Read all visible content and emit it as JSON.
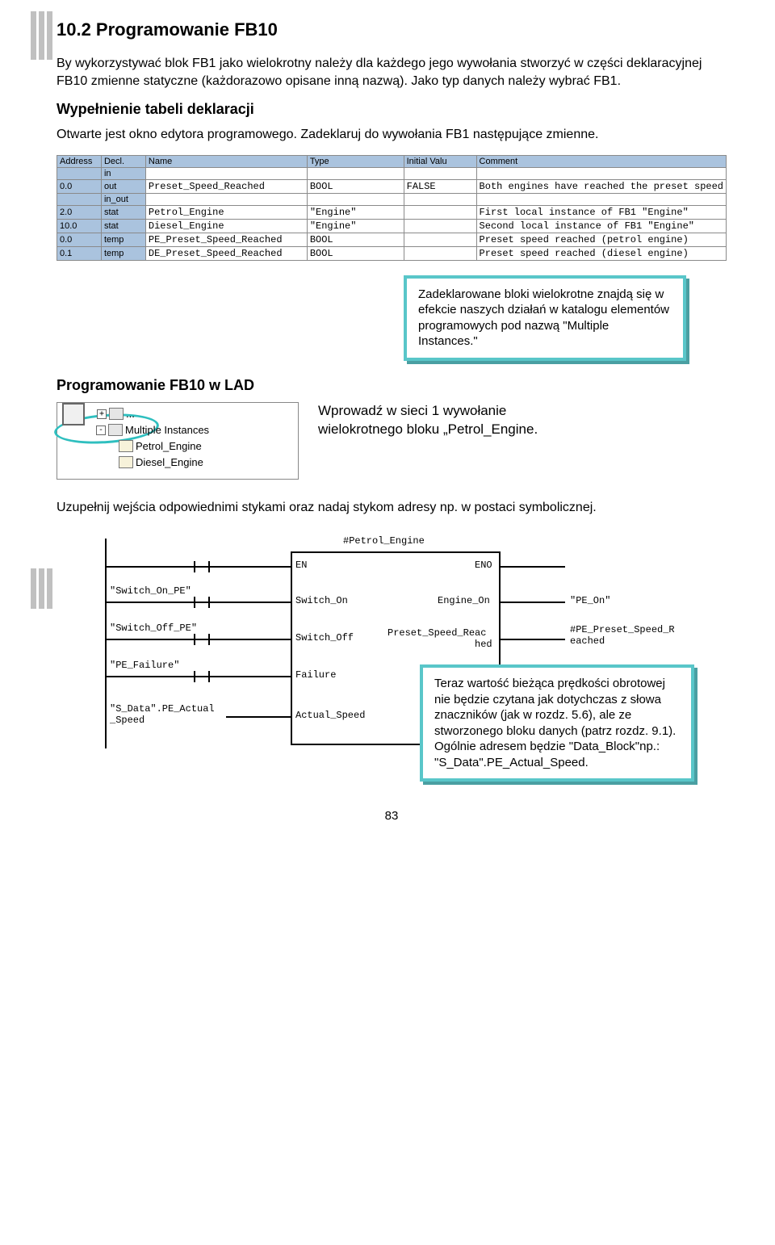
{
  "heading": "10.2 Programowanie FB10",
  "intro": "By wykorzystywać blok FB1 jako wielokrotny należy dla każdego jego wywołania stworzyć w części deklaracyjnej FB10 zmienne statyczne (każdorazowo opisane inną nazwą). Jako typ danych należy wybrać FB1.",
  "fill_title": "Wypełnienie tabeli deklaracji",
  "open_text": "Otwarte jest okno edytora programowego. Zadeklaruj do wywołania FB1 następujące zmienne.",
  "tbl": {
    "headers": [
      "Address",
      "Decl.",
      "Name",
      "Type",
      "Initial Valu",
      "Comment"
    ],
    "rows": [
      [
        "",
        "in",
        "",
        "",
        "",
        ""
      ],
      [
        "0.0",
        "out",
        "Preset_Speed_Reached",
        "BOOL",
        "FALSE",
        "Both engines have reached the preset speed"
      ],
      [
        "",
        "in_out",
        "",
        "",
        "",
        ""
      ],
      [
        "2.0",
        "stat",
        "Petrol_Engine",
        "\"Engine\"",
        "",
        "First local instance of FB1 \"Engine\""
      ],
      [
        "10.0",
        "stat",
        "Diesel_Engine",
        "\"Engine\"",
        "",
        "Second local instance of FB1 \"Engine\""
      ],
      [
        "0.0",
        "temp",
        "PE_Preset_Speed_Reached",
        "BOOL",
        "",
        "Preset speed reached (petrol engine)"
      ],
      [
        "0.1",
        "temp",
        "DE_Preset_Speed_Reached",
        "BOOL",
        "",
        "Preset speed reached (diesel engine)"
      ]
    ]
  },
  "callout1": "Zadeklarowane bloki wielokrotne znajdą się w efekcie naszych działań w katalogu elementów programowych pod nazwą \"Multiple Instances.\"",
  "lad_title": "Programowanie FB10 w LAD",
  "tree": {
    "items": [
      {
        "box": "+",
        "label": "...",
        "depth": 0
      },
      {
        "box": "-",
        "label": "Multiple Instances",
        "depth": 0,
        "bold": true
      },
      {
        "box": "",
        "label": "Petrol_Engine",
        "depth": 1
      },
      {
        "box": "",
        "label": "Diesel_Engine",
        "depth": 1
      }
    ]
  },
  "instr": "Wprowadź w sieci 1 wywołanie wielokrotnego bloku „Petrol_Engine.",
  "fill2": "Uzupełnij wejścia odpowiednimi stykami oraz nadaj stykom adresy np. w postaci symbolicznej.",
  "lad": {
    "title_center": "#Petrol_Engine",
    "ports": {
      "EN": "EN",
      "ENO": "ENO",
      "Switch_On": "Switch_On",
      "Switch_Off": "Switch_Off",
      "Failure": "Failure",
      "Actual_Speed": "Actual_Speed",
      "Engine_On": "Engine_On",
      "Preset": "Preset_Speed_Reac",
      "Preset2": "hed"
    },
    "in_labels": [
      "\"Switch_On_PE\"",
      "\"Switch_Off_PE\"",
      "\"PE_Failure\"",
      "\"S_Data\".PE_Actual",
      "_Speed"
    ],
    "out_labels": [
      "\"PE_On\"",
      "#PE_Preset_Speed_R",
      "eached"
    ]
  },
  "callout2": "Teraz wartość bieżąca prędkości obrotowej nie będzie czytana jak dotychczas z słowa znaczników (jak w rozdz. 5.6), ale ze stworzonego bloku danych (patrz rozdz. 9.1). Ogólnie adresem będzie \"Data_Block\"np.: \"S_Data\".PE_Actual_Speed.",
  "pagenum": "83"
}
